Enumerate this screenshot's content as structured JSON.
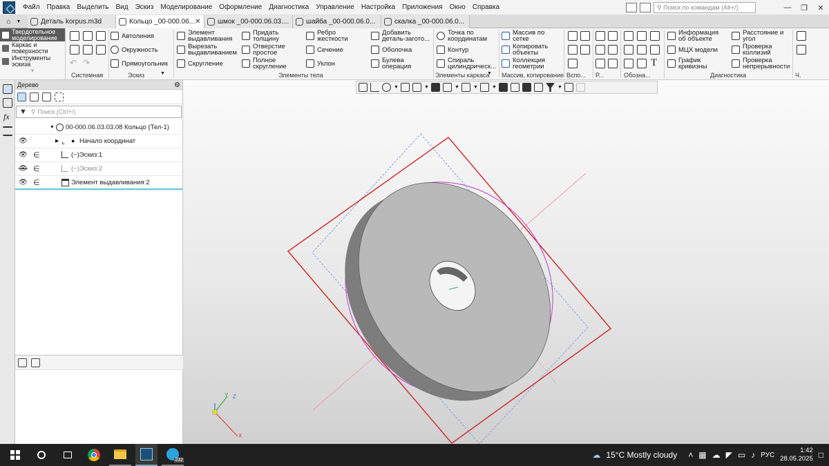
{
  "menu": [
    "Файл",
    "Правка",
    "Выделить",
    "Вид",
    "Эскиз",
    "Моделирование",
    "Оформление",
    "Диагностика",
    "Управление",
    "Настройка",
    "Приложения",
    "Окно",
    "Справка"
  ],
  "command_search": {
    "placeholder": "Поиск по командам (Alt+/)"
  },
  "tabs": [
    {
      "label": "Деталь korpus.m3d",
      "active": false
    },
    {
      "label": "Кольцо _00-000.06...",
      "active": true
    },
    {
      "label": "шмок _00-000.06.03....",
      "active": false
    },
    {
      "label": "шайба _00-000.06.0...",
      "active": false
    },
    {
      "label": "скалка _00-000.06.0...",
      "active": false
    }
  ],
  "modes": [
    {
      "label": "Твердотельное моделирование",
      "active": true
    },
    {
      "label": "Каркас и поверхности",
      "active": false
    },
    {
      "label": "Инструменты эскиза",
      "active": false
    }
  ],
  "ribbon": {
    "sketch_buttons": [
      "Автолиния",
      "Окружность",
      "Прямоугольник"
    ],
    "body_buttons": [
      "Элемент выдавливания",
      "Вырезать выдавливанием",
      "Скругление",
      "Придать толщину",
      "Отверстие простое",
      "Полное скругление",
      "Ребро жесткости",
      "Сечение",
      "Уклон",
      "Добавить деталь-загото...",
      "Оболочка",
      "Булева операция"
    ],
    "frame_buttons": [
      "Точка по координатам",
      "Контур",
      "Спираль цилиндрическ..."
    ],
    "copy_buttons": [
      "Массив по сетке",
      "Копировать объекты",
      "Коллекция геометрии"
    ],
    "diag_buttons": [
      "Информация об объекте",
      "МЦХ модели",
      "График кривизны",
      "Расстояние и угол",
      "Проверка коллизий",
      "Проверка непрерывности"
    ],
    "group_labels": {
      "system": "Системная",
      "sketch": "Эскиз",
      "body": "Элементы тела",
      "frame": "Элементы каркаса",
      "copy": "Массив, копирование",
      "aux": "Вспо...",
      "r": "Р...",
      "notation": "Обозна...",
      "diagnostics": "Диагностика",
      "ch": "Ч."
    }
  },
  "tree": {
    "title": "Дерево",
    "search_placeholder": "Поиск (Ctrl+/)",
    "items": [
      {
        "label": "00-000.06.03.03.08 Кольцо (Тел-1)"
      },
      {
        "label": "Начало координат"
      },
      {
        "label": "Эскиз:1"
      },
      {
        "label": "Эскиз:2"
      },
      {
        "label": "Элемент выдавливания:2"
      }
    ]
  },
  "axes": {
    "x": "X",
    "y": "Y",
    "z": "Z"
  },
  "taskbar": {
    "weather": "15°C  Mostly cloudy",
    "lang": "РУС",
    "time": "1:42",
    "date": "28.05.2025",
    "telegram_badge": "232"
  }
}
